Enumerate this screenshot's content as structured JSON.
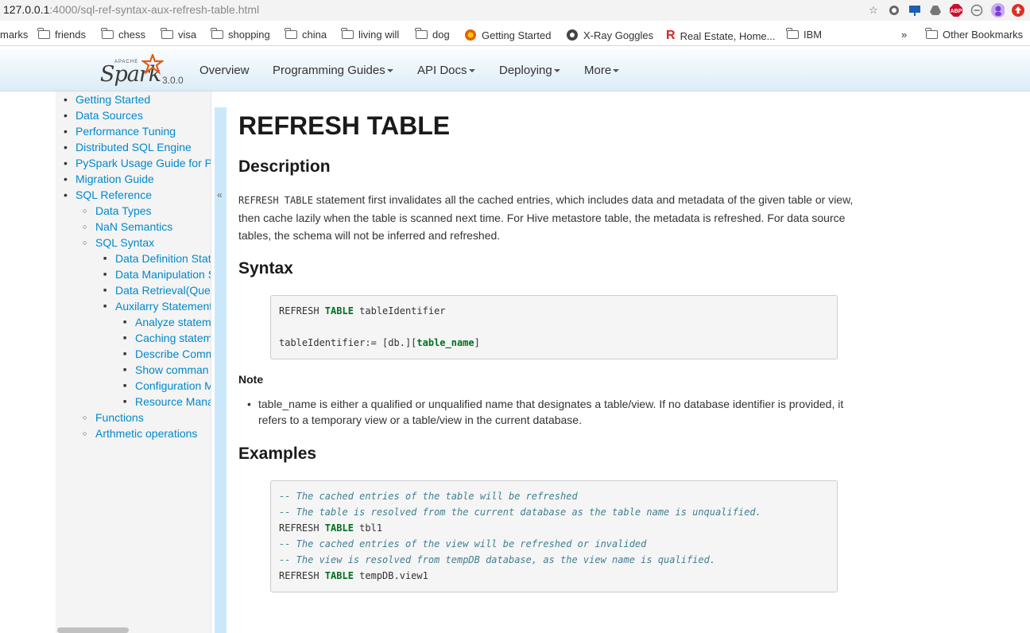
{
  "browser": {
    "url_host": "127.0.0.1",
    "url_path": ":4000/sql-ref-syntax-aux-refresh-table.html",
    "bookmarks": [
      {
        "label": "marks",
        "type": "text"
      },
      {
        "label": "friends",
        "type": "folder"
      },
      {
        "label": "chess",
        "type": "folder"
      },
      {
        "label": "visa",
        "type": "folder"
      },
      {
        "label": "shopping",
        "type": "folder"
      },
      {
        "label": "china",
        "type": "folder"
      },
      {
        "label": "living will",
        "type": "folder"
      },
      {
        "label": "dog",
        "type": "folder"
      },
      {
        "label": "Getting Started",
        "type": "firefox"
      },
      {
        "label": "X-Ray Goggles",
        "type": "globe"
      },
      {
        "label": "Real Estate, Home...",
        "type": "realtor"
      },
      {
        "label": "IBM",
        "type": "folder"
      },
      {
        "label": "»",
        "type": "overflow"
      },
      {
        "label": "Other Bookmarks",
        "type": "folder"
      }
    ],
    "abp_label": "ABP"
  },
  "nav": {
    "logo_word": "Spark",
    "logo_apache": "APACHE",
    "version": "3.0.0",
    "items": [
      "Overview",
      "Programming Guides",
      "API Docs",
      "Deploying",
      "More"
    ]
  },
  "sidebar": {
    "items": [
      {
        "label": "Getting Started",
        "level": 1
      },
      {
        "label": "Data Sources",
        "level": 1
      },
      {
        "label": "Performance Tuning",
        "level": 1
      },
      {
        "label": "Distributed SQL Engine",
        "level": 1
      },
      {
        "label": "PySpark Usage Guide for P",
        "level": 1
      },
      {
        "label": "Migration Guide",
        "level": 1
      },
      {
        "label": "SQL Reference",
        "level": 1
      },
      {
        "label": "Data Types",
        "level": 2
      },
      {
        "label": "NaN Semantics",
        "level": 2
      },
      {
        "label": "SQL Syntax",
        "level": 2
      },
      {
        "label": "Data Definition Stat",
        "level": 3
      },
      {
        "label": "Data Manipulation S",
        "level": 3
      },
      {
        "label": "Data Retrieval(Quer",
        "level": 3
      },
      {
        "label": "Auxilarry Statement",
        "level": 3
      },
      {
        "label": "Analyze statem",
        "level": 4
      },
      {
        "label": "Caching statem",
        "level": 4
      },
      {
        "label": "Describe Comm",
        "level": 4
      },
      {
        "label": "Show comman",
        "level": 4
      },
      {
        "label": "Configuration M",
        "level": 4
      },
      {
        "label": "Resource Mana",
        "level": 4
      },
      {
        "label": "Functions",
        "level": 2
      },
      {
        "label": "Arthmetic operations",
        "level": 2
      }
    ],
    "collapse_glyph": "«"
  },
  "content": {
    "title": "REFRESH TABLE",
    "description_heading": "Description",
    "description_code": "REFRESH TABLE",
    "description_text": " statement first invalidates all the cached entries, which includes data and metadata of the given table or view, then cache lazily when the table is scanned next time. For Hive metastore table, the metadata is refreshed. For data source tables, the schema will not be inferred and refreshed.",
    "syntax_heading": "Syntax",
    "syntax": {
      "l1_a": "REFRESH ",
      "l1_kw": "TABLE",
      "l1_b": " tableIdentifier",
      "l2_a": "tableIdentifier:= [db.][",
      "l2_kw": "table_name",
      "l2_b": "]"
    },
    "note_title": "Note",
    "note_text": "table_name is either a qualified or unqualified name that designates a table/view. If no database identifier is provided, it refers to a temporary view or a table/view in the current database.",
    "examples_heading": "Examples",
    "examples": {
      "c1": "-- The cached entries of the table will be refreshed",
      "c2": "-- The table is resolved from the current database as the table name is unqualified.",
      "s1_a": "REFRESH ",
      "s1_kw": "TABLE",
      "s1_b": " tbl1",
      "c3": "-- The cached entries of the view will be refreshed or invalided",
      "c4": "-- The view is resolved from tempDB database, as the view name is qualified.",
      "s2_a": "REFRESH ",
      "s2_kw": "TABLE",
      "s2_b": " tempDB.view1"
    }
  }
}
